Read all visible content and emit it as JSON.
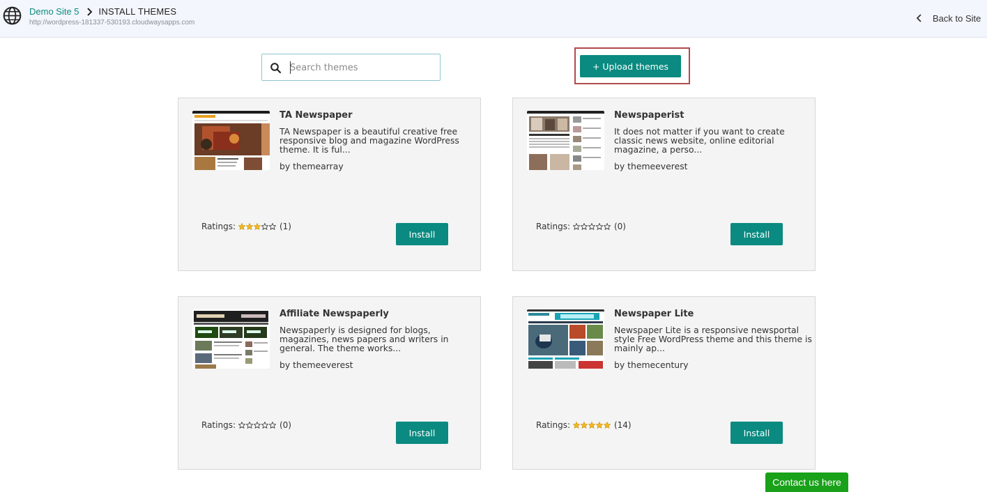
{
  "header": {
    "site_name": "Demo Site 5",
    "page_title": "INSTALL THEMES",
    "site_url": "http://wordpress-181337-530193.cloudwaysapps.com",
    "back_label": "Back to Site"
  },
  "search": {
    "placeholder": "Search themes",
    "value": ""
  },
  "upload": {
    "label": "+ Upload themes"
  },
  "ratings_label": "Ratings:",
  "colors": {
    "accent": "#0a8a80",
    "star_filled": "#f5b91f",
    "highlight_border": "#b14a4f",
    "contact": "#19a119"
  },
  "themes": [
    {
      "name": "TA Newspaper",
      "description": "TA Newspaper is a beautiful creative free responsive blog and magazine WordPress theme. It is ful...",
      "author": "by themearray",
      "stars": 3,
      "rating_count": "(1)",
      "install_label": "Install",
      "thumbnail_icon": "theme-preview-image"
    },
    {
      "name": "Newspaperist",
      "description": "It does not matter if you want to create classic news website, online editorial magazine, a perso...",
      "author": "by themeeverest",
      "stars": 0,
      "rating_count": "(0)",
      "install_label": "Install",
      "thumbnail_icon": "theme-preview-image"
    },
    {
      "name": "Affiliate Newspaperly",
      "description": "Newspaperly is designed for blogs, magazines, news papers and writers in general. The theme works...",
      "author": "by themeeverest",
      "stars": 0,
      "rating_count": "(0)",
      "install_label": "Install",
      "thumbnail_icon": "theme-preview-image"
    },
    {
      "name": "Newspaper Lite",
      "description": "Newspaper Lite is a responsive newsportal style Free WordPress theme and this theme is mainly ap...",
      "author": "by themecentury",
      "stars": 5,
      "rating_count": "(14)",
      "install_label": "Install",
      "thumbnail_icon": "theme-preview-image"
    }
  ],
  "contact": {
    "label": "Contact us here"
  }
}
